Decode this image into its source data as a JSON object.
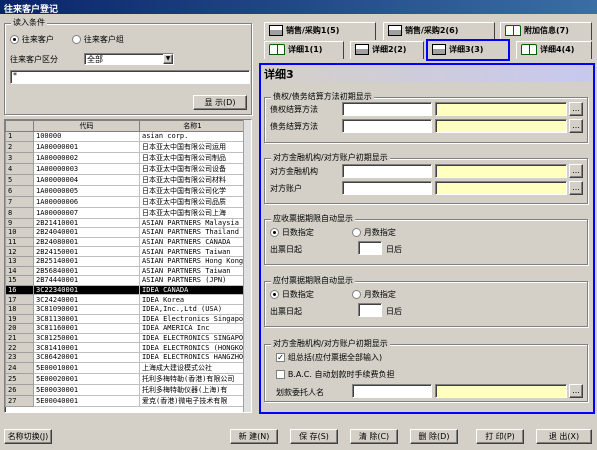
{
  "window": {
    "title": "往来客户登记"
  },
  "filter": {
    "group_title": "读入条件",
    "radio_customer": "往来客户",
    "radio_group": "往来客户组",
    "class_label": "往来客户区分",
    "class_value": "全部",
    "input_value": "*",
    "show_button": "显 示(D)"
  },
  "grid": {
    "headers": [
      "",
      "代码",
      "名称1"
    ],
    "selected_index": 15,
    "rows": [
      [
        "1",
        "100000",
        "asian corp."
      ],
      [
        "2",
        "1A00000001",
        "日本亚太中国有限公司运用"
      ],
      [
        "3",
        "1A00000002",
        "日本亚太中国有限公司制品"
      ],
      [
        "4",
        "1A00000003",
        "日本亚太中国有限公司设备"
      ],
      [
        "5",
        "1A00000004",
        "日本亚太中国有限公司材料"
      ],
      [
        "6",
        "1A00000005",
        "日本亚太中国有限公司化学"
      ],
      [
        "7",
        "1A00000006",
        "日本亚太中国有限公司品质"
      ],
      [
        "8",
        "1A00000007",
        "日本亚太中国有限公司上海"
      ],
      [
        "9",
        "2B21410001",
        "ASIAN PARTNERS Malaysia"
      ],
      [
        "10",
        "2B24040001",
        "ASIAN PARTNERS Thailand"
      ],
      [
        "11",
        "2B24080001",
        "ASIAN PARTNERS CANADA"
      ],
      [
        "12",
        "2B24150001",
        "ASIAN PARTNERS Taiwan"
      ],
      [
        "13",
        "2B25140001",
        "ASIAN PARTNERS Hong Kong"
      ],
      [
        "14",
        "2B56840001",
        "ASIAN PARTNERS Taiwan"
      ],
      [
        "15",
        "2B74440001",
        "ASIAN PARTNERS (JPN)"
      ],
      [
        "16",
        "3C22340001",
        "IDEA CANADA"
      ],
      [
        "17",
        "3C24240001",
        "IDEA Korea"
      ],
      [
        "18",
        "3C81090001",
        "IDEA,Inc.,Ltd (USA)"
      ],
      [
        "19",
        "3C81130001",
        "IDEA Electronics Singapor"
      ],
      [
        "20",
        "3C81160001",
        "IDEA AMERICA Inc"
      ],
      [
        "21",
        "3C81250001",
        "IDEA ELECTRONICS SINGAPOR"
      ],
      [
        "22",
        "3C81410001",
        "IDEA ELECTRONICS (HONGKON"
      ],
      [
        "23",
        "3C86420001",
        "IDEA ELECTRONICS HANGZHOU"
      ],
      [
        "24",
        "5E00010001",
        "上海成大建设模式公社"
      ],
      [
        "25",
        "5E00020001",
        "托利多梅特勒(香港)有限公司"
      ],
      [
        "26",
        "5E00030001",
        "托利多梅特勒仪器(上海)有"
      ],
      [
        "27",
        "5E00040001",
        "爱克(香港)微电子技术有限"
      ]
    ]
  },
  "tabs": {
    "row1": [
      "销售/采购1(5)",
      "销售/采购2(6)",
      "附加信息(7)"
    ],
    "row2": [
      "详细1(1)",
      "详细2(2)",
      "详细3(3)",
      "详细4(4)"
    ]
  },
  "panel": {
    "title": "详细3",
    "sec1": {
      "title": "债权/债务结算方法初期显示",
      "row1": "债权结算方法",
      "row2": "债务结算方法"
    },
    "sec2": {
      "title": "对方金融机构/对方账户初期显示",
      "row1": "对方金融机构",
      "row2": "对方账户"
    },
    "sec3": {
      "title": "应收票据期限自动显示",
      "r1": "日数指定",
      "r2": "月数指定",
      "date": "出票日起",
      "unit": "日后"
    },
    "sec4": {
      "title": "应付票据期限自动显示",
      "r1": "日数指定",
      "r2": "月数指定",
      "date": "出票日起",
      "unit": "日后"
    },
    "sec5": {
      "title": "对方金融机构/对方账户初期显示",
      "c1": "组总括(应付票据全部输入)",
      "c2": "B.A.C. 自动划款时手续费负担",
      "transfer": "划款委托人名"
    },
    "ellipsis": "..."
  },
  "footer": {
    "switch": "名称切换(J)",
    "new": "新 建(N)",
    "save": "保 存(S)",
    "clear": "清 除(C)",
    "delete": "删 除(D)",
    "print": "打 印(P)",
    "exit": "退 出(X)"
  }
}
